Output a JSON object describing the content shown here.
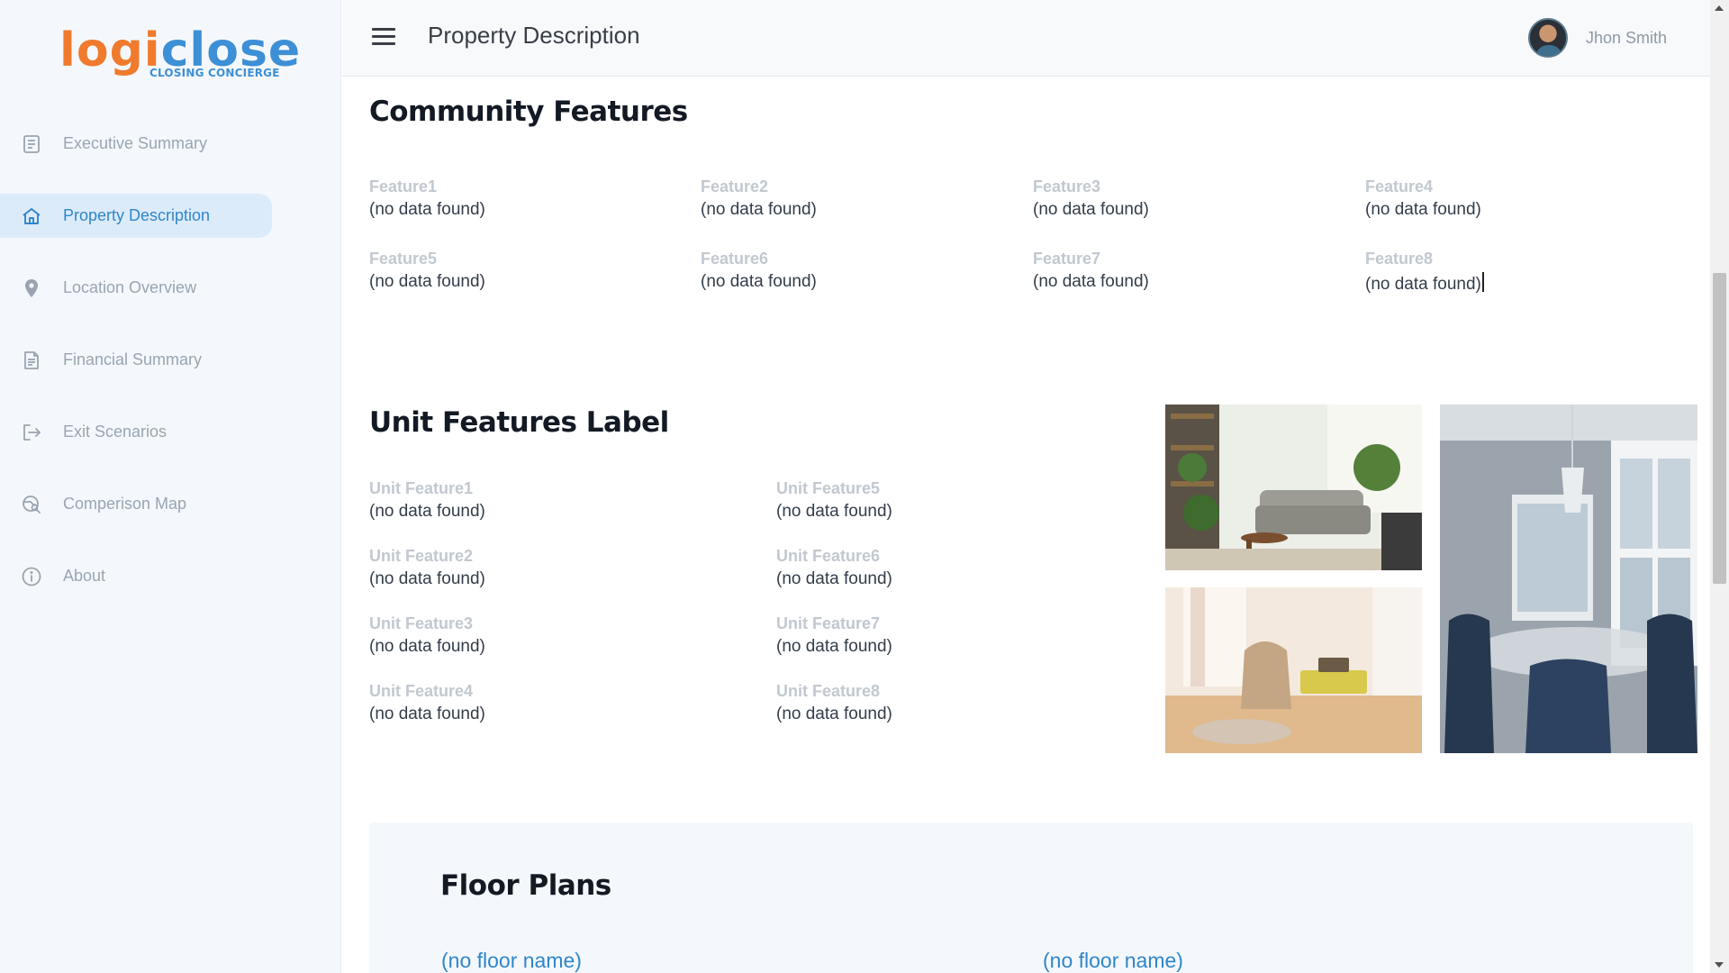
{
  "brand": {
    "logo_prefix": "l",
    "logo_orange": "o",
    "logo_mid": "gi",
    "logo_rest": "close",
    "tagline": "CLOSING CONCIERGE"
  },
  "sidebar": {
    "items": [
      {
        "label": "Executive Summary",
        "icon": "document-list-icon",
        "active": false
      },
      {
        "label": "Property Description",
        "icon": "home-icon",
        "active": true
      },
      {
        "label": "Location Overview",
        "icon": "location-pin-icon",
        "active": false
      },
      {
        "label": "Financial Summary",
        "icon": "document-text-icon",
        "active": false
      },
      {
        "label": "Exit Scenarios",
        "icon": "exit-icon",
        "active": false
      },
      {
        "label": "Comperison Map",
        "icon": "map-search-icon",
        "active": false
      },
      {
        "label": "About",
        "icon": "info-icon",
        "active": false
      }
    ]
  },
  "header": {
    "title": "Property Description",
    "user_name": "Jhon Smith"
  },
  "community": {
    "title": "Community Features",
    "features": [
      {
        "label": "Feature1",
        "value": "(no data found)"
      },
      {
        "label": "Feature2",
        "value": "(no data found)"
      },
      {
        "label": "Feature3",
        "value": "(no data found)"
      },
      {
        "label": "Feature4",
        "value": "(no data found)"
      },
      {
        "label": "Feature5",
        "value": "(no data found)"
      },
      {
        "label": "Feature6",
        "value": "(no data found)"
      },
      {
        "label": "Feature7",
        "value": "(no data found)"
      },
      {
        "label": "Feature8",
        "value": "(no data found)"
      }
    ]
  },
  "unit": {
    "title": "Unit Features Label",
    "features": [
      {
        "label": "Unit Feature1",
        "value": "(no data found)"
      },
      {
        "label": "Unit Feature2",
        "value": "(no data found)"
      },
      {
        "label": "Unit Feature3",
        "value": "(no data found)"
      },
      {
        "label": "Unit Feature4",
        "value": "(no data found)"
      },
      {
        "label": "Unit Feature5",
        "value": "(no data found)"
      },
      {
        "label": "Unit Feature6",
        "value": "(no data found)"
      },
      {
        "label": "Unit Feature7",
        "value": "(no data found)"
      },
      {
        "label": "Unit Feature8",
        "value": "(no data found)"
      }
    ]
  },
  "floor_plans": {
    "title": "Floor Plans",
    "names": [
      "(no floor name)",
      "(no floor name)"
    ]
  },
  "colors": {
    "accent": "#2f86c9",
    "brand_orange": "#f07a2d",
    "active_bg": "#dcebfa"
  }
}
